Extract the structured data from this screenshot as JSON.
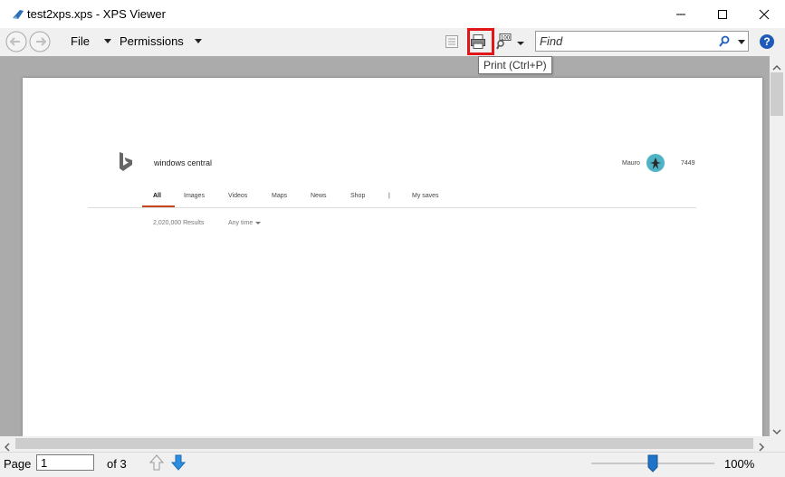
{
  "window": {
    "title": "test2xps.xps - XPS Viewer",
    "controls": {
      "minimize": "minimize",
      "maximize": "maximize",
      "close": "close"
    }
  },
  "toolbar": {
    "menus": [
      {
        "label": "File"
      },
      {
        "label": "Permissions"
      }
    ],
    "find_placeholder": "Find",
    "tooltip": "Print (Ctrl+P)",
    "highlight_color": "#e0161a",
    "zoom_icon_label": "100"
  },
  "document": {
    "search_query": "windows central",
    "user_name": "Mauro",
    "rewards_points": "7449",
    "tabs": [
      "All",
      "Images",
      "Videos",
      "Maps",
      "News",
      "Shop",
      "|",
      "My saves"
    ],
    "results_count": "2,020,000 Results",
    "time_filter": "Any time",
    "accent_color": "#c8441e"
  },
  "statusbar": {
    "page_label": "Page",
    "page_value": "1",
    "page_total": "of 3",
    "zoom": "100%",
    "zoom_level": 0.5
  }
}
